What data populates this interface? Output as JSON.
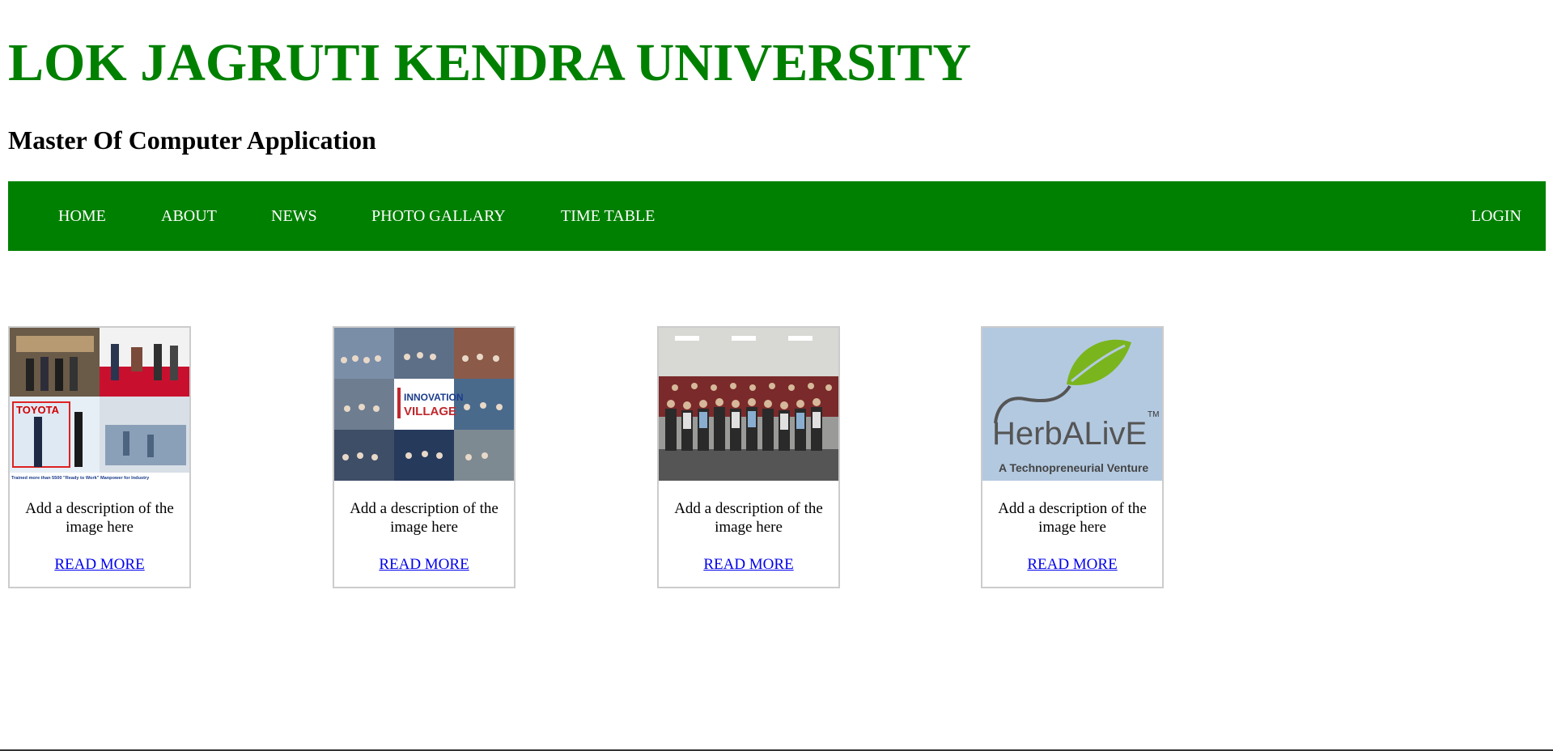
{
  "header": {
    "title": "LOK JAGRUTI KENDRA UNIVERSITY",
    "subtitle": "Master Of Computer Application"
  },
  "nav": {
    "items": [
      {
        "label": "HOME"
      },
      {
        "label": "ABOUT"
      },
      {
        "label": "NEWS"
      },
      {
        "label": "PHOTO GALLARY"
      },
      {
        "label": "TIME TABLE"
      }
    ],
    "login_label": "LOGIN"
  },
  "cards": [
    {
      "image_desc": "collage: award ceremony and training photos",
      "image_text": {
        "brand": "TOYOTA",
        "caption": "Trained more than 5500 \"Ready to Work\" Manpower for Industry"
      },
      "description": "Add a description of the image here",
      "link_label": "READ MORE"
    },
    {
      "image_desc": "collage: innovation village event photos",
      "image_text": {
        "line1": "INNOVATION",
        "line2": "VILLAGE"
      },
      "description": "Add a description of the image here",
      "link_label": "READ MORE"
    },
    {
      "image_desc": "group photo of students in auditorium",
      "description": "Add a description of the image here",
      "link_label": "READ MORE"
    },
    {
      "image_desc": "HerbALivE logo with leaf",
      "image_text": {
        "brand": "HerbALivE",
        "tm": "TM",
        "tagline": "A Technopreneurial Venture"
      },
      "description": "Add a description of the image here",
      "link_label": "READ MORE"
    }
  ],
  "colors": {
    "brand_green": "#008000",
    "link_blue": "#0000ee",
    "card_border": "#cccccc",
    "herbalive_bg": "#b3c9e0",
    "herbalive_leaf": "#7ab51d"
  }
}
